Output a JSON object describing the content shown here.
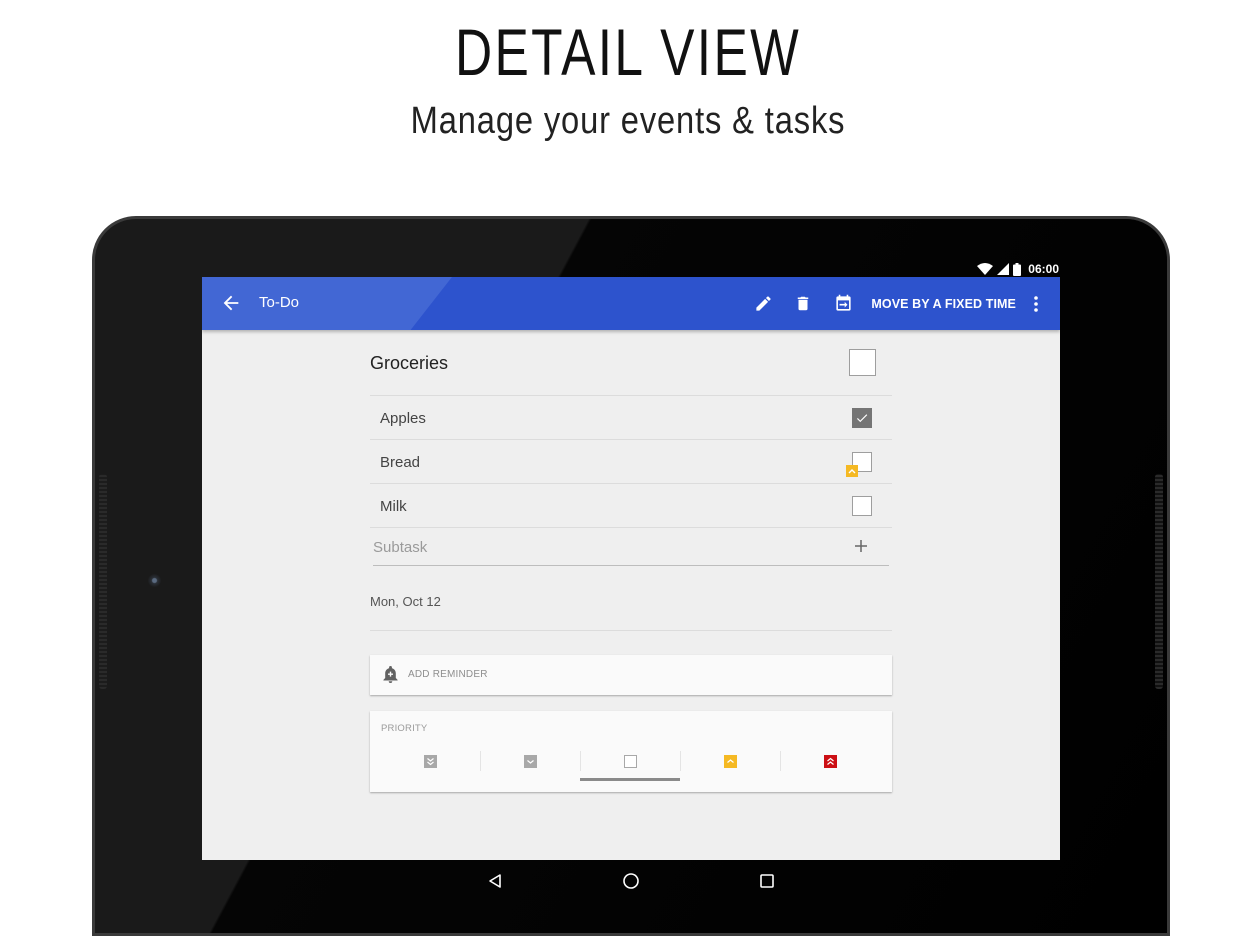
{
  "promo": {
    "title": "DETAIL VIEW",
    "subtitle": "Manage your events & tasks"
  },
  "status_bar": {
    "icons": [
      "wifi-icon",
      "signal-icon",
      "battery-icon"
    ],
    "time": "06:00"
  },
  "app_bar": {
    "back_icon": "arrow-left-icon",
    "title": "To-Do",
    "actions": [
      {
        "icon": "pencil-icon",
        "name": "edit"
      },
      {
        "icon": "trash-icon",
        "name": "delete"
      },
      {
        "icon": "calendar-move-icon",
        "name": "move-to-date"
      }
    ],
    "text_action": "MOVE BY A FIXED TIME",
    "overflow_icon": "more-vert-icon",
    "color": "#2d53cd"
  },
  "task": {
    "title": "Groceries",
    "completed": false,
    "subtasks": [
      {
        "label": "Apples",
        "checked": true,
        "priority_flag": null
      },
      {
        "label": "Bread",
        "checked": false,
        "priority_flag": "high"
      },
      {
        "label": "Milk",
        "checked": false,
        "priority_flag": null
      }
    ],
    "subtask_placeholder": "Subtask",
    "subtask_value": "",
    "add_icon": "plus-icon",
    "date": "Mon, Oct 12"
  },
  "reminder": {
    "icon": "bell-plus-icon",
    "label": "ADD REMINDER"
  },
  "priority": {
    "label": "PRIORITY",
    "options": [
      {
        "name": "lowest",
        "icon": "double-chevron-down-icon",
        "color": "#a8a8a8"
      },
      {
        "name": "low",
        "icon": "chevron-down-icon",
        "color": "#a8a8a8"
      },
      {
        "name": "normal",
        "icon": "square-outline-icon",
        "color": "#a8a8a8"
      },
      {
        "name": "high",
        "icon": "chevron-up-icon",
        "color": "#f5b923"
      },
      {
        "name": "highest",
        "icon": "double-chevron-up-icon",
        "color": "#cc0f14"
      }
    ],
    "selected": "normal"
  },
  "nav_bar": {
    "buttons": [
      "back-triangle-icon",
      "home-circle-icon",
      "recents-square-icon"
    ]
  }
}
